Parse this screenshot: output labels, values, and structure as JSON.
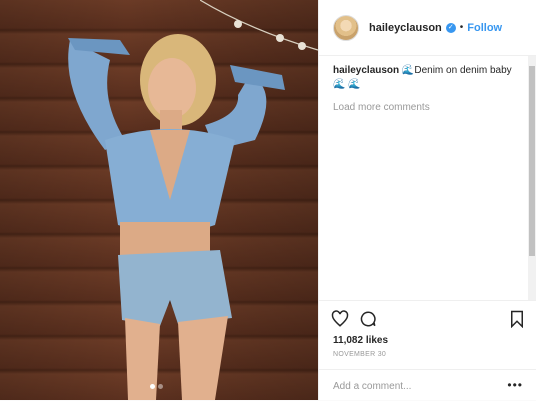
{
  "post": {
    "image": {
      "description_icon": "photo",
      "carousel_dots": 2,
      "active_dot": 1
    },
    "header": {
      "username": "haileyclauson",
      "verified_icon": "verified-badge-icon",
      "separator": "•",
      "follow_label": "Follow"
    },
    "caption": {
      "username": "haileyclauson",
      "text": " 🌊Denim on denim baby🌊 🌊"
    },
    "load_more_label": "Load more comments",
    "likes": "11,082 likes",
    "date": "NOVEMBER 30",
    "comment_input": {
      "placeholder": "Add a comment..."
    },
    "more_label": "•••",
    "colors": {
      "accent": "#3897f0",
      "text": "#262626",
      "muted": "#999999"
    }
  }
}
